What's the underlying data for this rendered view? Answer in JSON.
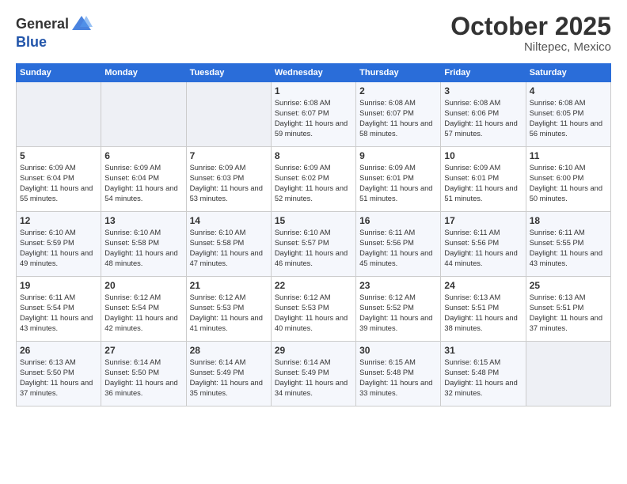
{
  "header": {
    "logo_general": "General",
    "logo_blue": "Blue",
    "month": "October 2025",
    "location": "Niltepec, Mexico"
  },
  "days_of_week": [
    "Sunday",
    "Monday",
    "Tuesday",
    "Wednesday",
    "Thursday",
    "Friday",
    "Saturday"
  ],
  "weeks": [
    [
      {
        "day": "",
        "empty": true
      },
      {
        "day": "",
        "empty": true
      },
      {
        "day": "",
        "empty": true
      },
      {
        "day": "1",
        "sunrise": "6:08 AM",
        "sunset": "6:07 PM",
        "daylight": "11 hours and 59 minutes."
      },
      {
        "day": "2",
        "sunrise": "6:08 AM",
        "sunset": "6:07 PM",
        "daylight": "11 hours and 58 minutes."
      },
      {
        "day": "3",
        "sunrise": "6:08 AM",
        "sunset": "6:06 PM",
        "daylight": "11 hours and 57 minutes."
      },
      {
        "day": "4",
        "sunrise": "6:08 AM",
        "sunset": "6:05 PM",
        "daylight": "11 hours and 56 minutes."
      }
    ],
    [
      {
        "day": "5",
        "sunrise": "6:09 AM",
        "sunset": "6:04 PM",
        "daylight": "11 hours and 55 minutes."
      },
      {
        "day": "6",
        "sunrise": "6:09 AM",
        "sunset": "6:04 PM",
        "daylight": "11 hours and 54 minutes."
      },
      {
        "day": "7",
        "sunrise": "6:09 AM",
        "sunset": "6:03 PM",
        "daylight": "11 hours and 53 minutes."
      },
      {
        "day": "8",
        "sunrise": "6:09 AM",
        "sunset": "6:02 PM",
        "daylight": "11 hours and 52 minutes."
      },
      {
        "day": "9",
        "sunrise": "6:09 AM",
        "sunset": "6:01 PM",
        "daylight": "11 hours and 51 minutes."
      },
      {
        "day": "10",
        "sunrise": "6:09 AM",
        "sunset": "6:01 PM",
        "daylight": "11 hours and 51 minutes."
      },
      {
        "day": "11",
        "sunrise": "6:10 AM",
        "sunset": "6:00 PM",
        "daylight": "11 hours and 50 minutes."
      }
    ],
    [
      {
        "day": "12",
        "sunrise": "6:10 AM",
        "sunset": "5:59 PM",
        "daylight": "11 hours and 49 minutes."
      },
      {
        "day": "13",
        "sunrise": "6:10 AM",
        "sunset": "5:58 PM",
        "daylight": "11 hours and 48 minutes."
      },
      {
        "day": "14",
        "sunrise": "6:10 AM",
        "sunset": "5:58 PM",
        "daylight": "11 hours and 47 minutes."
      },
      {
        "day": "15",
        "sunrise": "6:10 AM",
        "sunset": "5:57 PM",
        "daylight": "11 hours and 46 minutes."
      },
      {
        "day": "16",
        "sunrise": "6:11 AM",
        "sunset": "5:56 PM",
        "daylight": "11 hours and 45 minutes."
      },
      {
        "day": "17",
        "sunrise": "6:11 AM",
        "sunset": "5:56 PM",
        "daylight": "11 hours and 44 minutes."
      },
      {
        "day": "18",
        "sunrise": "6:11 AM",
        "sunset": "5:55 PM",
        "daylight": "11 hours and 43 minutes."
      }
    ],
    [
      {
        "day": "19",
        "sunrise": "6:11 AM",
        "sunset": "5:54 PM",
        "daylight": "11 hours and 43 minutes."
      },
      {
        "day": "20",
        "sunrise": "6:12 AM",
        "sunset": "5:54 PM",
        "daylight": "11 hours and 42 minutes."
      },
      {
        "day": "21",
        "sunrise": "6:12 AM",
        "sunset": "5:53 PM",
        "daylight": "11 hours and 41 minutes."
      },
      {
        "day": "22",
        "sunrise": "6:12 AM",
        "sunset": "5:53 PM",
        "daylight": "11 hours and 40 minutes."
      },
      {
        "day": "23",
        "sunrise": "6:12 AM",
        "sunset": "5:52 PM",
        "daylight": "11 hours and 39 minutes."
      },
      {
        "day": "24",
        "sunrise": "6:13 AM",
        "sunset": "5:51 PM",
        "daylight": "11 hours and 38 minutes."
      },
      {
        "day": "25",
        "sunrise": "6:13 AM",
        "sunset": "5:51 PM",
        "daylight": "11 hours and 37 minutes."
      }
    ],
    [
      {
        "day": "26",
        "sunrise": "6:13 AM",
        "sunset": "5:50 PM",
        "daylight": "11 hours and 37 minutes."
      },
      {
        "day": "27",
        "sunrise": "6:14 AM",
        "sunset": "5:50 PM",
        "daylight": "11 hours and 36 minutes."
      },
      {
        "day": "28",
        "sunrise": "6:14 AM",
        "sunset": "5:49 PM",
        "daylight": "11 hours and 35 minutes."
      },
      {
        "day": "29",
        "sunrise": "6:14 AM",
        "sunset": "5:49 PM",
        "daylight": "11 hours and 34 minutes."
      },
      {
        "day": "30",
        "sunrise": "6:15 AM",
        "sunset": "5:48 PM",
        "daylight": "11 hours and 33 minutes."
      },
      {
        "day": "31",
        "sunrise": "6:15 AM",
        "sunset": "5:48 PM",
        "daylight": "11 hours and 32 minutes."
      },
      {
        "day": "",
        "empty": true
      }
    ]
  ],
  "labels": {
    "sunrise": "Sunrise:",
    "sunset": "Sunset:",
    "daylight": "Daylight:"
  }
}
